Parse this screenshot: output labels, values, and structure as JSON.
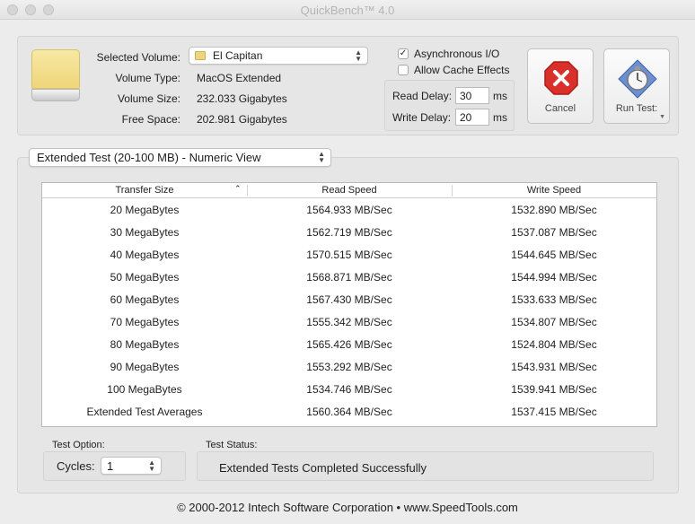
{
  "window": {
    "title": "QuickBench™ 4.0"
  },
  "volume": {
    "selected_label": "Selected Volume:",
    "selected_value": "El Capitan",
    "type_label": "Volume Type:",
    "type_value": "MacOS Extended",
    "size_label": "Volume Size:",
    "size_value": "232.033 Gigabytes",
    "free_label": "Free Space:",
    "free_value": "202.981 Gigabytes"
  },
  "options": {
    "async_label": "Asynchronous I/O",
    "async_checked": "✓",
    "cache_label": "Allow Cache Effects",
    "read_delay_label": "Read Delay:",
    "read_delay_value": "30",
    "read_delay_unit": "ms",
    "write_delay_label": "Write Delay:",
    "write_delay_value": "20",
    "write_delay_unit": "ms"
  },
  "buttons": {
    "cancel_label": "Cancel",
    "run_label": "Run Test:"
  },
  "view_select": {
    "value": "Extended Test (20-100 MB) - Numeric View"
  },
  "table": {
    "headers": [
      "Transfer Size",
      "Read Speed",
      "Write Speed"
    ],
    "rows": [
      [
        "20 MegaBytes",
        "1564.933 MB/Sec",
        "1532.890 MB/Sec"
      ],
      [
        "30 MegaBytes",
        "1562.719 MB/Sec",
        "1537.087 MB/Sec"
      ],
      [
        "40 MegaBytes",
        "1570.515 MB/Sec",
        "1544.645 MB/Sec"
      ],
      [
        "50 MegaBytes",
        "1568.871 MB/Sec",
        "1544.994 MB/Sec"
      ],
      [
        "60 MegaBytes",
        "1567.430 MB/Sec",
        "1533.633 MB/Sec"
      ],
      [
        "70 MegaBytes",
        "1555.342 MB/Sec",
        "1534.807 MB/Sec"
      ],
      [
        "80 MegaBytes",
        "1565.426 MB/Sec",
        "1524.804 MB/Sec"
      ],
      [
        "90 MegaBytes",
        "1553.292 MB/Sec",
        "1543.931 MB/Sec"
      ],
      [
        "100 MegaBytes",
        "1534.746 MB/Sec",
        "1539.941 MB/Sec"
      ],
      [
        "Extended Test Averages",
        "1560.364 MB/Sec",
        "1537.415 MB/Sec"
      ]
    ]
  },
  "test_option": {
    "label": "Test Option:",
    "cycles_label": "Cycles:",
    "cycles_value": "1"
  },
  "test_status": {
    "label": "Test Status:",
    "value": "Extended Tests Completed Successfully"
  },
  "footer": {
    "text": "© 2000-2012 Intech Software Corporation • www.SpeedTools.com"
  },
  "icons": {
    "cancel": "cancel-x-icon",
    "run": "stopwatch-icon",
    "drive": "hard-drive-icon",
    "volume": "folder-icon"
  },
  "colors": {
    "cancel_red": "#d9302b",
    "run_blue": "#6d8fcf",
    "drive_yellow": "#efd57a"
  }
}
